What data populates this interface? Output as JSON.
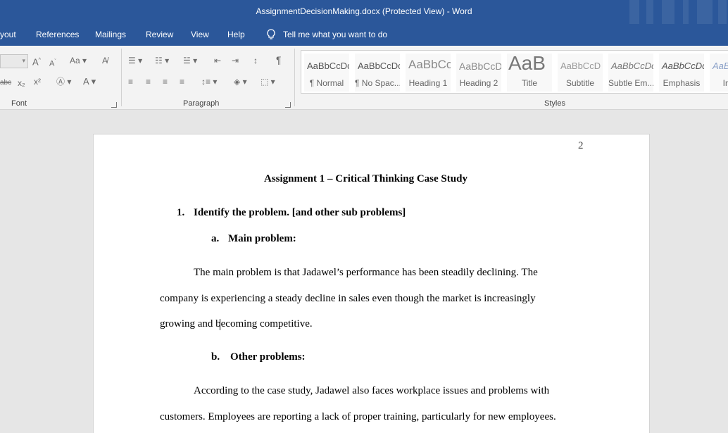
{
  "window": {
    "title": "AssignmentDecisionMaking.docx (Protected View)  -  Word"
  },
  "menu": {
    "tabs": [
      "yout",
      "References",
      "Mailings",
      "Review",
      "View",
      "Help"
    ],
    "tell_me": "Tell me what you want to do"
  },
  "ribbon": {
    "font_group_label": "Font",
    "paragraph_group_label": "Paragraph",
    "styles_group_label": "Styles",
    "styles": [
      {
        "preview": "AaBbCcDc",
        "name": "¶ Normal"
      },
      {
        "preview": "AaBbCcDc",
        "name": "¶ No Spac..."
      },
      {
        "preview": "AaBbCc",
        "name": "Heading 1"
      },
      {
        "preview": "AaBbCcD",
        "name": "Heading 2"
      },
      {
        "preview": "AaB",
        "name": "Title"
      },
      {
        "preview": "AaBbCcD",
        "name": "Subtitle"
      },
      {
        "preview": "AaBbCcDc",
        "name": "Subtle Em..."
      },
      {
        "preview": "AaBbCcDc",
        "name": "Emphasis"
      },
      {
        "preview": "AaBbCcDc",
        "name": "Inten"
      }
    ]
  },
  "document": {
    "page_number": "2",
    "title": "Assignment 1 – Critical Thinking Case Study",
    "item1_number": "1.",
    "item1_text": "Identify the problem. [and other sub problems]",
    "sub_a_letter": "a.",
    "sub_a_text": "Main problem:",
    "para1_line1": "The main problem is that Jadawel’s performance has been steadily declining. The",
    "para1_line2": "company is experiencing a steady decline in sales even though the market is increasingly",
    "para1_line3": "growing and becoming competitive.",
    "sub_b_letter": "b.",
    "sub_b_text": "Other problems:",
    "para2_line1": "According to the case study, Jadawel also faces workplace issues and problems with",
    "para2_line2": "customers. Employees are reporting a lack of proper training, particularly for new employees."
  }
}
